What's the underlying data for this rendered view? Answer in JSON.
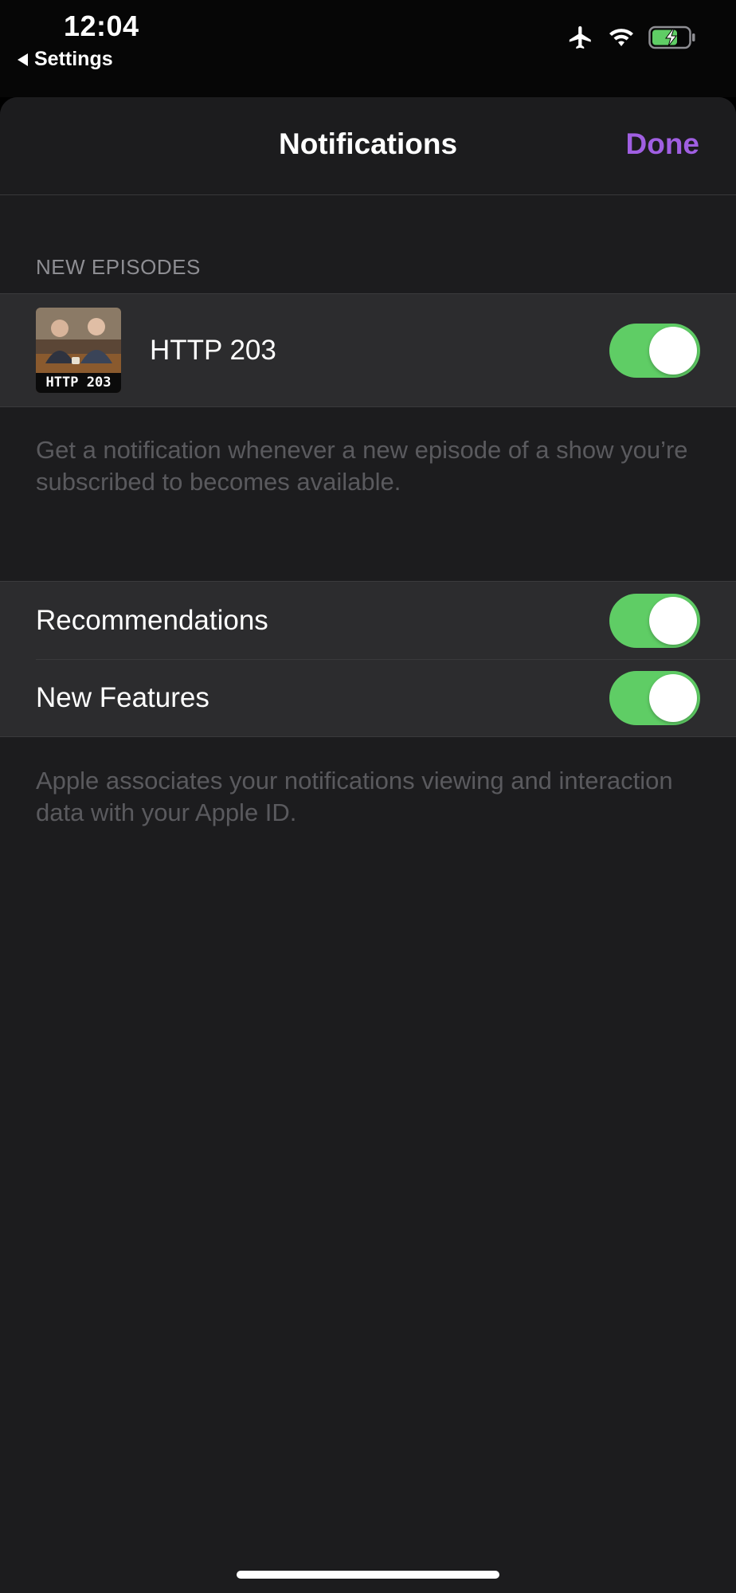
{
  "status_bar": {
    "time": "12:04",
    "back_label": "Settings",
    "icons": [
      "airplane-icon",
      "wifi-icon",
      "battery-charging-icon"
    ],
    "battery_color": "#5fcd65"
  },
  "nav": {
    "title": "Notifications",
    "done_label": "Done",
    "accent_color": "#a05fe2"
  },
  "new_episodes": {
    "header": "NEW EPISODES",
    "shows": [
      {
        "title": "HTTP 203",
        "artwork_caption": "HTTP 203",
        "enabled": true
      }
    ],
    "footer": "Get a notification whenever a new episode of a show you’re subscribed to becomes available."
  },
  "other": {
    "rows": [
      {
        "label": "Recommendations",
        "enabled": true
      },
      {
        "label": "New Features",
        "enabled": true
      }
    ],
    "footer": "Apple associates your notifications viewing and interaction data with your Apple ID."
  },
  "toggle_on_color": "#5fcd65"
}
